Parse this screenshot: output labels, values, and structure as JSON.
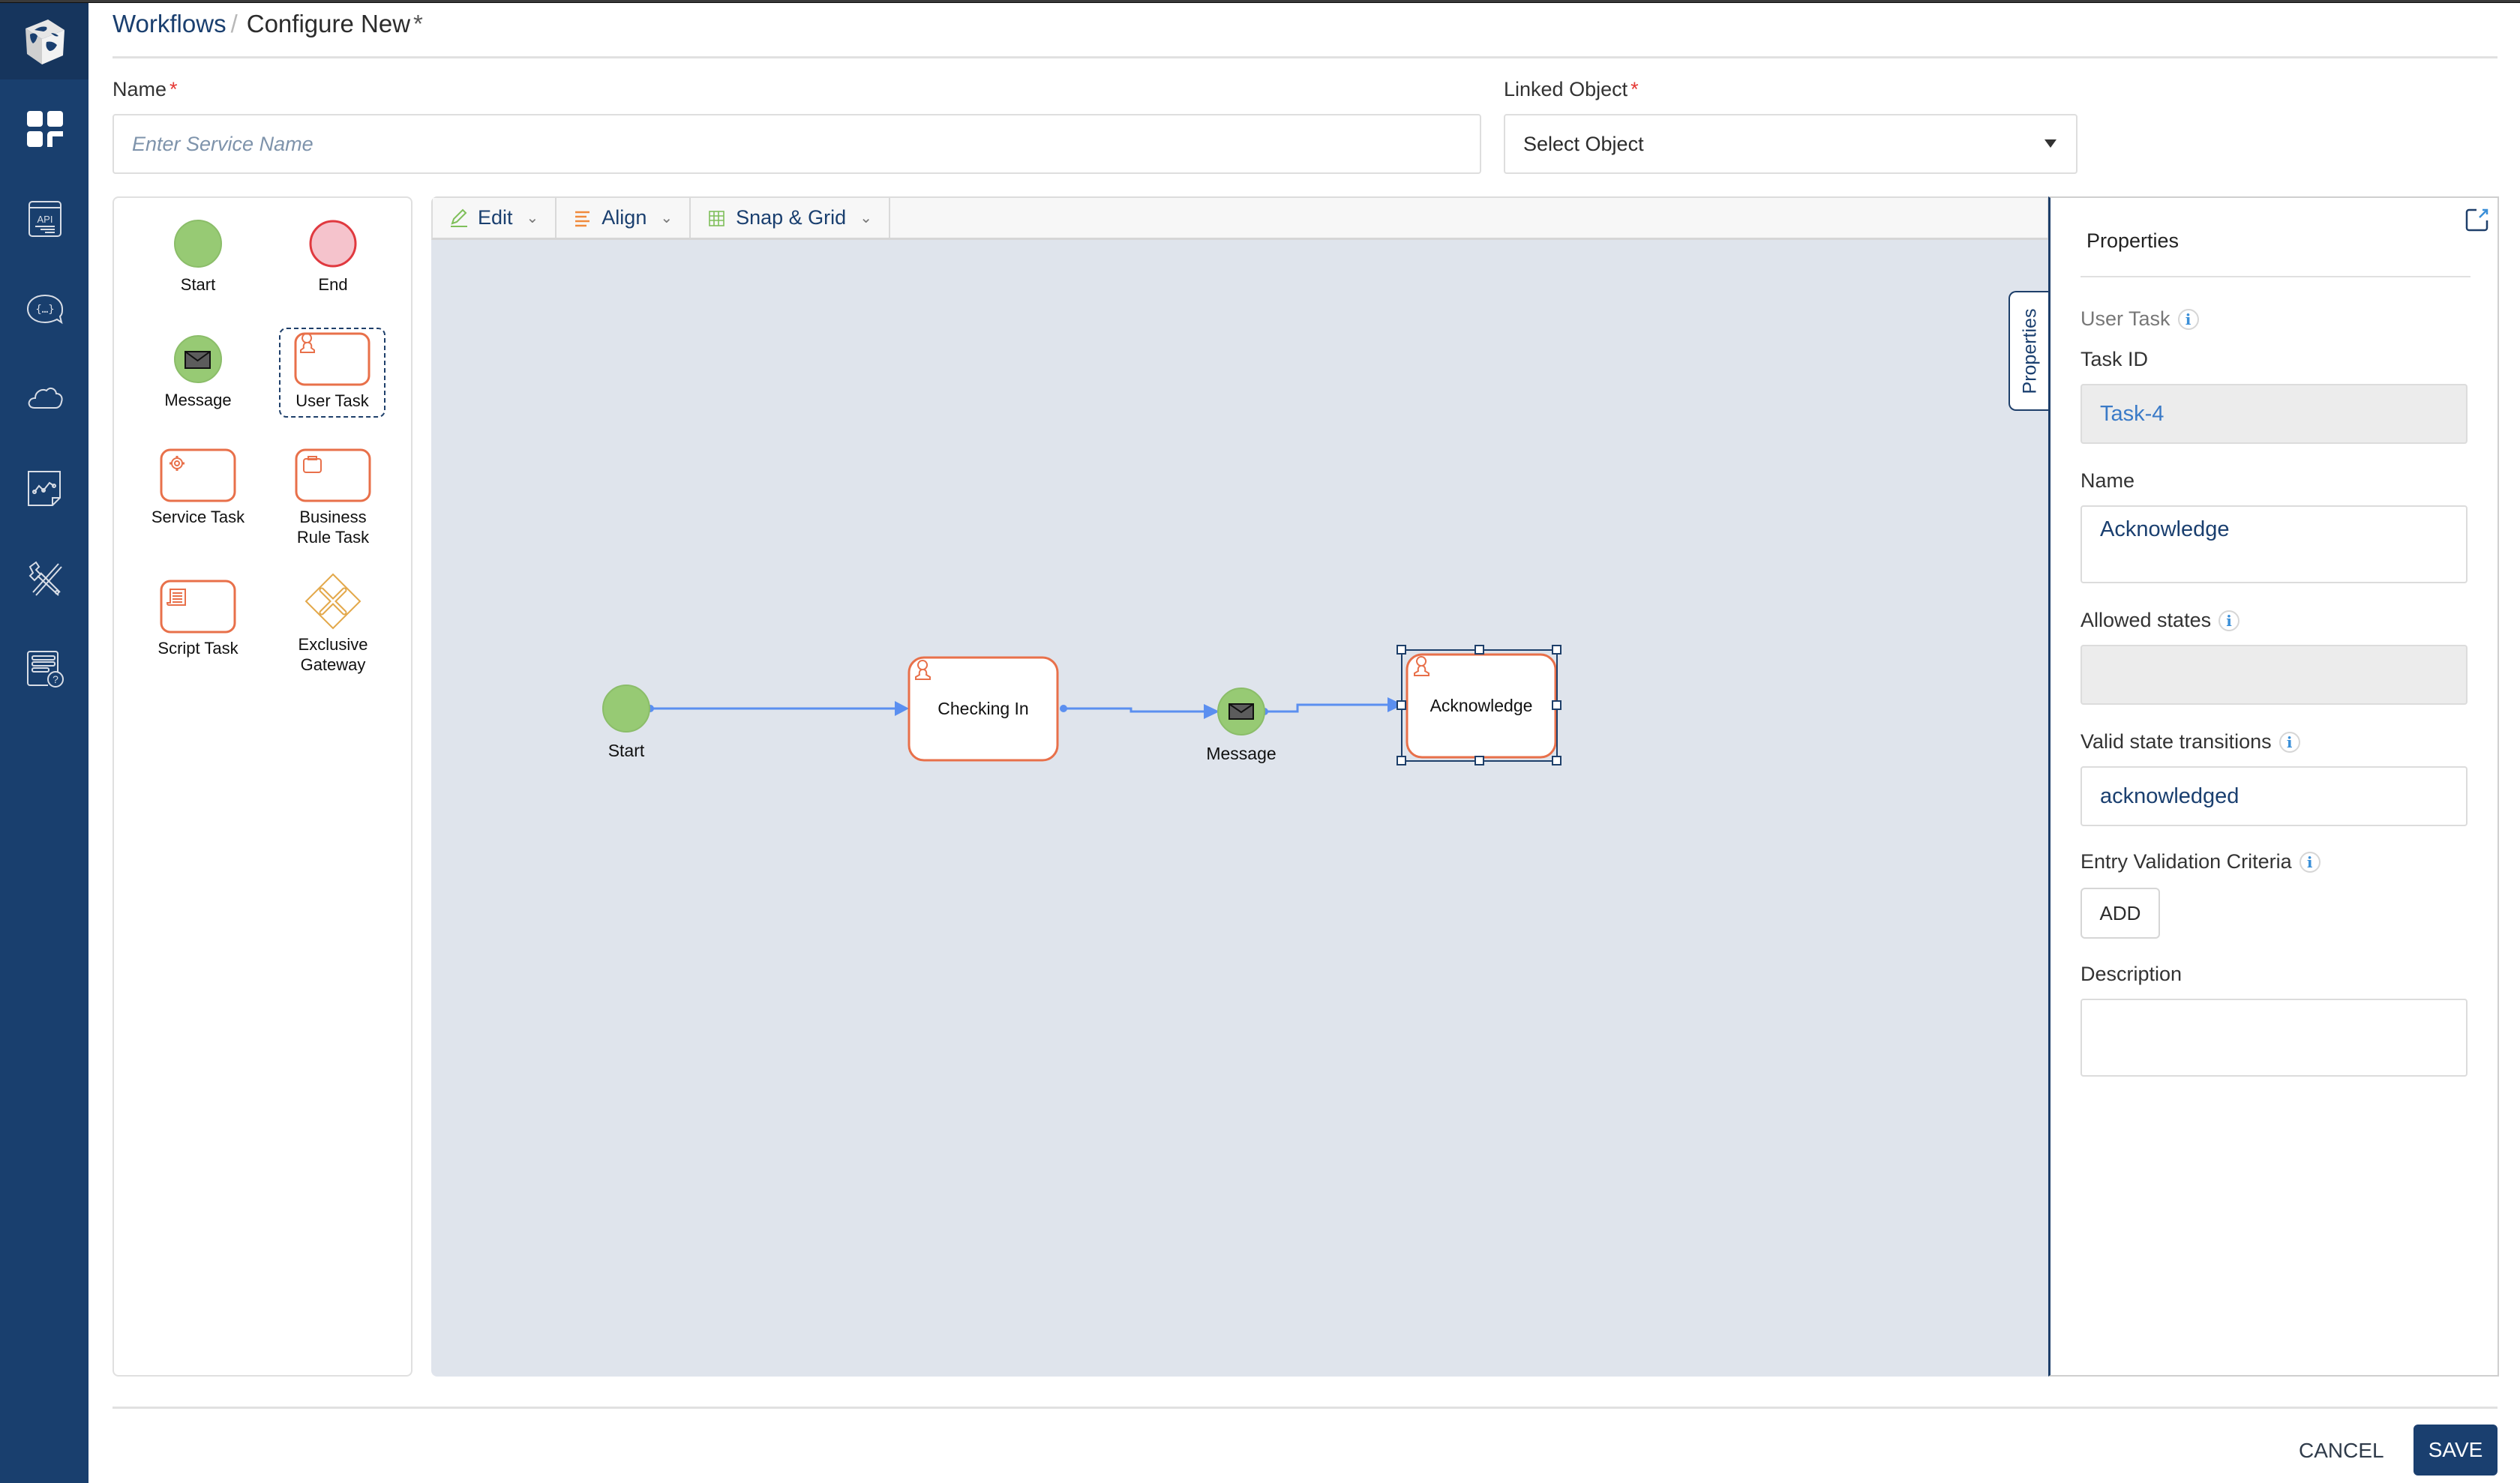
{
  "breadcrumb": {
    "parent": "Workflows",
    "separator": "/",
    "current": "Configure New",
    "unsaved_marker": "*"
  },
  "form": {
    "name_label": "Name",
    "name_required": "*",
    "name_value": "",
    "name_placeholder": "Enter Service Name",
    "linked_object_label": "Linked Object",
    "linked_object_required": "*",
    "linked_object_value": "Select Object"
  },
  "sidebar": {
    "items": [
      {
        "icon": "dashboard-icon"
      },
      {
        "icon": "api-icon"
      },
      {
        "icon": "code-chat-icon"
      },
      {
        "icon": "cloud-icon"
      },
      {
        "icon": "analytics-document-icon"
      },
      {
        "icon": "tools-icon"
      },
      {
        "icon": "help-form-icon"
      }
    ]
  },
  "palette": {
    "items": [
      {
        "label": "Start",
        "type": "start-event"
      },
      {
        "label": "End",
        "type": "end-event"
      },
      {
        "label": "Message",
        "type": "message-event"
      },
      {
        "label": "User Task",
        "type": "user-task",
        "selected": true
      },
      {
        "label": "Service Task",
        "type": "service-task"
      },
      {
        "label": "Business Rule Task",
        "type": "business-rule-task"
      },
      {
        "label": "Script Task",
        "type": "script-task"
      },
      {
        "label": "Exclusive Gateway",
        "type": "exclusive-gateway"
      }
    ]
  },
  "toolbar": {
    "edit_label": "Edit",
    "align_label": "Align",
    "snap_grid_label": "Snap & Grid"
  },
  "diagram": {
    "nodes": [
      {
        "id": "start",
        "type": "start-event",
        "label": "Start"
      },
      {
        "id": "checking_in",
        "type": "user-task",
        "label": "Checking In"
      },
      {
        "id": "message",
        "type": "message-event",
        "label": "Message"
      },
      {
        "id": "acknowledge",
        "type": "user-task",
        "label": "Acknowledge",
        "selected": true
      }
    ],
    "edges": [
      {
        "from": "start",
        "to": "checking_in"
      },
      {
        "from": "checking_in",
        "to": "message"
      },
      {
        "from": "message",
        "to": "acknowledge"
      }
    ]
  },
  "properties": {
    "tab_label": "Properties",
    "title": "Properties",
    "element_type": "User Task",
    "task_id_label": "Task ID",
    "task_id_value": "Task-4",
    "name_label": "Name",
    "name_value": "Acknowledge",
    "allowed_states_label": "Allowed states",
    "allowed_states_value": "",
    "valid_transitions_label": "Valid state transitions",
    "valid_transitions_value": "acknowledged",
    "entry_validation_label": "Entry Validation Criteria",
    "add_label": "ADD",
    "description_label": "Description",
    "description_value": ""
  },
  "footer": {
    "cancel_label": "CANCEL",
    "save_label": "SAVE"
  },
  "colors": {
    "sidebar_bg": "#193f6e",
    "brand_primary": "#1a3f6f",
    "task_border": "#e8704a",
    "start_fill": "#97ca74",
    "end_fill": "#f5c3cc",
    "end_stroke": "#e0393f",
    "gateway_stroke": "#e3a84a",
    "edge_color": "#5b8ff0",
    "canvas_bg": "#dfe4ec"
  }
}
